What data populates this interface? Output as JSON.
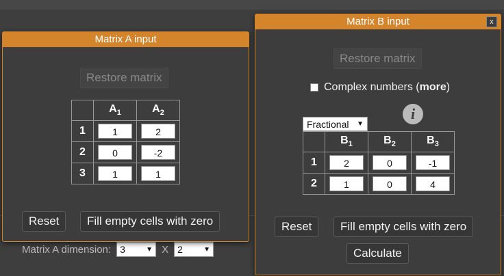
{
  "background": {
    "matrix_a_dimension_label": "Matrix A dimension:",
    "rows_value": "3",
    "x_label": "X",
    "cols_value": "2"
  },
  "dialog_a": {
    "title": "Matrix A input",
    "restore_label": "Restore matrix",
    "col_headers": [
      "A",
      "A"
    ],
    "col_subs": [
      "1",
      "2"
    ],
    "rows": [
      {
        "label": "1",
        "values": [
          "1",
          "2"
        ]
      },
      {
        "label": "2",
        "values": [
          "0",
          "-2"
        ]
      },
      {
        "label": "3",
        "values": [
          "1",
          "1"
        ]
      }
    ],
    "reset_label": "Reset",
    "fill_label": "Fill empty cells with zero"
  },
  "dialog_b": {
    "title": "Matrix B input",
    "close_label": "x",
    "restore_label": "Restore matrix",
    "complex_label": "Complex numbers (",
    "more_label": "more",
    "complex_suffix": ")",
    "info_glyph": "i",
    "format_value": "Fractional",
    "col_headers": [
      "B",
      "B",
      "B"
    ],
    "col_subs": [
      "1",
      "2",
      "3"
    ],
    "rows": [
      {
        "label": "1",
        "values": [
          "2",
          "0",
          "-1"
        ]
      },
      {
        "label": "2",
        "values": [
          "1",
          "0",
          "4"
        ]
      }
    ],
    "reset_label": "Reset",
    "fill_label": "Fill empty cells with zero",
    "calculate_label": "Calculate"
  },
  "colors": {
    "accent": "#d4842a",
    "panel": "#3d3d3d"
  }
}
